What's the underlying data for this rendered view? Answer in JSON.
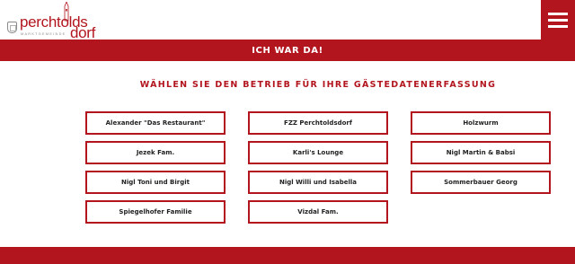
{
  "header": {
    "logo_text_1": "perchtolds",
    "logo_text_2": "dorf",
    "logo_subtitle": "MARKTGEMEINDE"
  },
  "banner": {
    "text": "ICH WAR DA!"
  },
  "main": {
    "heading": "WÄHLEN SIE DEN BETRIEB FÜR IHRE GÄSTEDATENERFASSUNG",
    "businesses": [
      "Alexander \"Das Restaurant\"",
      "FZZ Perchtoldsdorf",
      "Holzwurm",
      "Jezek Fam.",
      "Karli's Lounge",
      "Nigl Martin & Babsi",
      "Nigl Toni und Birgit",
      "Nigl Willi und Isabella",
      "Sommerbauer Georg",
      "Spiegelhofer Familie",
      "Vizdal Fam."
    ]
  },
  "colors": {
    "brand_red": "#b3151e",
    "text_dark": "#222222"
  }
}
